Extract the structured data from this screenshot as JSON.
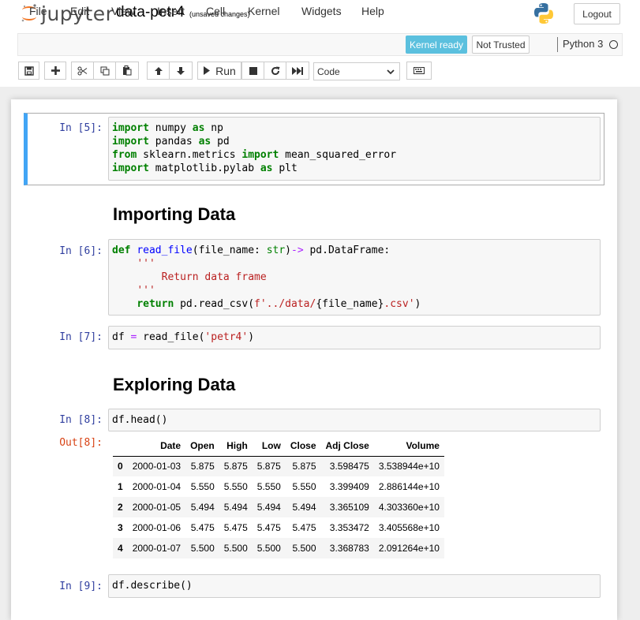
{
  "header": {
    "logo_text": "jupyter",
    "notebook_title": "data-petr4",
    "autosave_status": "(unsaved changes)",
    "logout_label": "Logout"
  },
  "menubar": {
    "items": [
      "File",
      "Edit",
      "View",
      "Insert",
      "Cell",
      "Kernel",
      "Widgets",
      "Help"
    ],
    "kernel_status": "Kernel ready",
    "trust_status": "Not Trusted",
    "kernel_name": "Python 3"
  },
  "toolbar": {
    "run_label": "Run",
    "cell_type": "Code"
  },
  "cells": [
    {
      "prompt": "In [5]:",
      "code": [
        [
          [
            "kw",
            "import"
          ],
          [
            "",
            "numpy "
          ],
          [
            "kw",
            "as"
          ],
          [
            "",
            "np"
          ]
        ],
        [
          [
            "kw",
            "import"
          ],
          [
            "",
            "pandas "
          ],
          [
            "kw",
            "as"
          ],
          [
            "",
            "pd"
          ]
        ],
        [
          [
            "kw",
            "from"
          ],
          [
            "",
            "sklearn.metrics "
          ],
          [
            "kw",
            "import"
          ],
          [
            "",
            "mean_squared_error"
          ]
        ],
        [
          [
            "kw",
            "import"
          ],
          [
            "",
            "matplotlib.pylab "
          ],
          [
            "kw",
            "as"
          ],
          [
            "",
            "plt"
          ]
        ]
      ]
    },
    {
      "heading": "Importing Data"
    },
    {
      "prompt": "In [6]:",
      "code": [
        [
          [
            "kw",
            "def"
          ],
          [
            "",
            ""
          ],
          [
            "fn",
            "read_file"
          ],
          [
            "",
            "(file_name: "
          ],
          [
            "bi",
            "str"
          ],
          [
            "",
            ")"
          ],
          [
            "op",
            "->"
          ],
          [
            "",
            "pd.DataFrame:"
          ]
        ],
        [
          [
            "",
            "    "
          ],
          [
            "str",
            "'''"
          ]
        ],
        [
          [
            "",
            "        "
          ],
          [
            "str",
            "Return data frame"
          ]
        ],
        [
          [
            "",
            "    "
          ],
          [
            "str",
            "'''"
          ]
        ],
        [
          [
            "",
            "    "
          ],
          [
            "kw",
            "return"
          ],
          [
            "",
            ""
          ],
          [
            "",
            "pd.read_csv("
          ],
          [
            "str",
            "f'../data/"
          ],
          [
            "",
            "{file_name}"
          ],
          [
            "str",
            ".csv'"
          ],
          [
            "",
            ")"
          ]
        ]
      ]
    },
    {
      "prompt": "In [7]:",
      "code": [
        [
          [
            "",
            "df "
          ],
          [
            "op",
            "="
          ],
          [
            "",
            ""
          ],
          [
            "",
            "read_file("
          ],
          [
            "str",
            "'petr4'"
          ],
          [
            "",
            ")"
          ]
        ]
      ]
    },
    {
      "heading": "Exploring Data"
    },
    {
      "prompt": "In [8]:",
      "code": [
        [
          [
            "",
            "df.head()"
          ]
        ]
      ],
      "out_prompt": "Out[8]:",
      "table": {
        "columns": [
          "",
          "Date",
          "Open",
          "High",
          "Low",
          "Close",
          "Adj Close",
          "Volume"
        ],
        "rows": [
          [
            "0",
            "2000-01-03",
            "5.875",
            "5.875",
            "5.875",
            "5.875",
            "3.598475",
            "3.538944e+10"
          ],
          [
            "1",
            "2000-01-04",
            "5.550",
            "5.550",
            "5.550",
            "5.550",
            "3.399409",
            "2.886144e+10"
          ],
          [
            "2",
            "2000-01-05",
            "5.494",
            "5.494",
            "5.494",
            "5.494",
            "3.365109",
            "4.303360e+10"
          ],
          [
            "3",
            "2000-01-06",
            "5.475",
            "5.475",
            "5.475",
            "5.475",
            "3.353472",
            "3.405568e+10"
          ],
          [
            "4",
            "2000-01-07",
            "5.500",
            "5.500",
            "5.500",
            "5.500",
            "3.368783",
            "2.091264e+10"
          ]
        ]
      }
    },
    {
      "prompt": "In [9]:",
      "code": [
        [
          [
            "",
            "df.describe()"
          ]
        ]
      ]
    }
  ],
  "colors": {
    "selected_border": "#42a5f5",
    "in_prompt": "#303f9f",
    "out_prompt": "#d84315",
    "kernel_ready_bg": "#5bc0de"
  }
}
